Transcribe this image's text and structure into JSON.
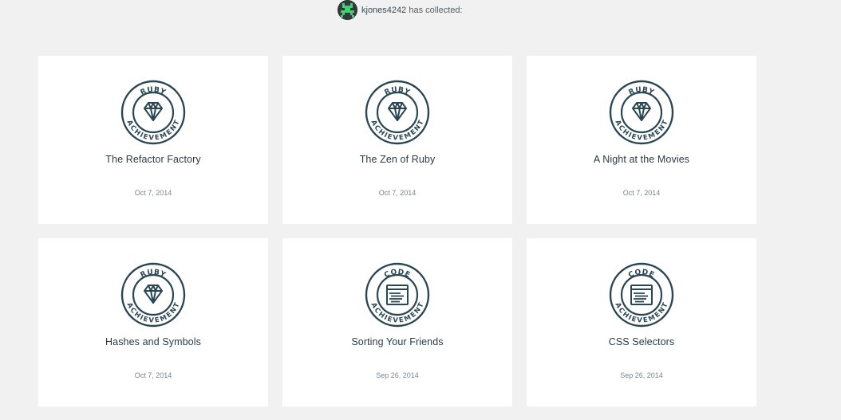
{
  "header": {
    "username": "kjones4242",
    "suffix": "has collected:",
    "avatar_icon": "pixel-avatar"
  },
  "colors": {
    "background": "#f0f1f0",
    "card": "#ffffff",
    "badge": "#2a4654",
    "avatar_green": "#3bd46a"
  },
  "cards": [
    {
      "badge_type": "ruby",
      "badge_top": "RUBY",
      "badge_bottom": "ACHIEVEMENT",
      "icon": "diamond-icon",
      "title": "The Refactor Factory",
      "date": "Oct 7, 2014"
    },
    {
      "badge_type": "ruby",
      "badge_top": "RUBY",
      "badge_bottom": "ACHIEVEMENT",
      "icon": "diamond-icon",
      "title": "The Zen of Ruby",
      "date": "Oct 7, 2014"
    },
    {
      "badge_type": "ruby",
      "badge_top": "RUBY",
      "badge_bottom": "ACHIEVEMENT",
      "icon": "diamond-icon",
      "title": "A Night at the Movies",
      "date": "Oct 7, 2014"
    },
    {
      "badge_type": "ruby",
      "badge_top": "RUBY",
      "badge_bottom": "ACHIEVEMENT",
      "icon": "diamond-icon",
      "title": "Hashes and Symbols",
      "date": "Oct 7, 2014"
    },
    {
      "badge_type": "code",
      "badge_top": "CODE",
      "badge_bottom": "ACHIEVEMENT",
      "icon": "code-window-icon",
      "title": "Sorting Your Friends",
      "date": "Sep 26, 2014"
    },
    {
      "badge_type": "code",
      "badge_top": "CODE",
      "badge_bottom": "ACHIEVEMENT",
      "icon": "code-window-icon",
      "title": "CSS Selectors",
      "date": "Sep 26, 2014"
    }
  ]
}
